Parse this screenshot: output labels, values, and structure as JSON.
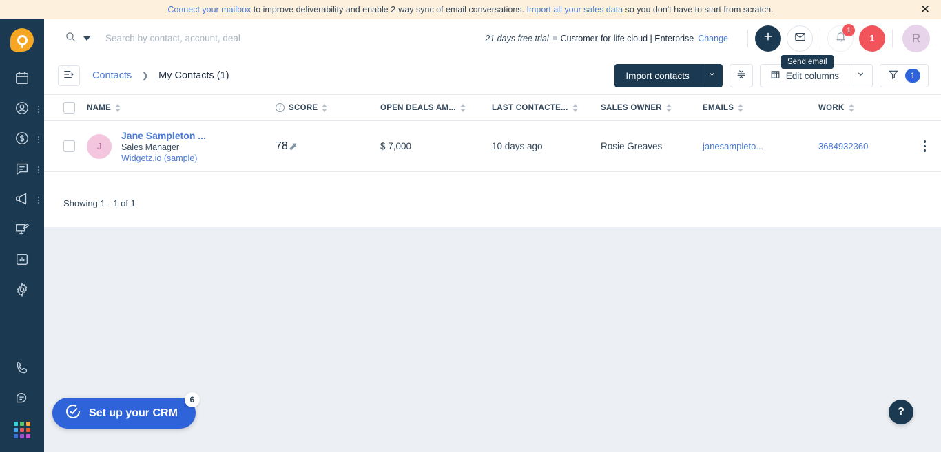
{
  "banner": {
    "link1": "Connect your mailbox",
    "text1": " to improve deliverability and enable 2-way sync of email conversations. ",
    "link2": "Import all your sales data",
    "text2": " so you don't have to start from scratch.",
    "close_icon": "close-icon"
  },
  "sidebar": {
    "logo_name": "freshworks-logo",
    "items": [
      {
        "name": "calendar",
        "icon": "calendar-icon",
        "has_dots": false
      },
      {
        "name": "contacts",
        "icon": "person-circle-icon",
        "has_dots": true
      },
      {
        "name": "deals",
        "icon": "dollar-circle-icon",
        "has_dots": true
      },
      {
        "name": "conversations",
        "icon": "chat-icon",
        "has_dots": true
      },
      {
        "name": "marketing",
        "icon": "megaphone-icon",
        "has_dots": true
      },
      {
        "name": "web-forms",
        "icon": "monitor-edit-icon",
        "has_dots": false
      },
      {
        "name": "reports",
        "icon": "bar-chart-icon",
        "has_dots": false
      },
      {
        "name": "settings",
        "icon": "gear-icon",
        "has_dots": false
      }
    ],
    "bottom_items": [
      {
        "name": "phone",
        "icon": "phone-icon"
      },
      {
        "name": "chat-support",
        "icon": "speech-bubble-icon"
      },
      {
        "name": "app-switcher",
        "icon": "app-grid-icon"
      }
    ],
    "app_grid_colors": [
      "#3ed0d6",
      "#4aa6f0",
      "#5cc46a",
      "#f0a93c",
      "#4aa6f0",
      "#f2545b",
      "#e05c2e",
      "#3d6fd0",
      "#a14fd0",
      "#c94fd0"
    ]
  },
  "topbar": {
    "search_icon": "search-icon",
    "search_dropdown_icon": "caret-down-icon",
    "search_placeholder": "Search by contact, account, deal",
    "search_value": "",
    "trial_days": "21 days free trial",
    "plan": "Customer-for-life cloud | Enterprise",
    "change_label": "Change",
    "add_icon": "plus-icon",
    "mail_icon": "envelope-icon",
    "mail_tooltip": "Send email",
    "bell_icon": "bell-icon",
    "bell_badge": "1",
    "count_badge": "1",
    "avatar_initial": "R"
  },
  "pagebar": {
    "panel_toggle_icon": "panel-toggle-icon",
    "breadcrumb_root": "Contacts",
    "breadcrumb_sep_icon": "chevron-right-icon",
    "breadcrumb_current": "My Contacts (1)",
    "import_label": "Import contacts",
    "import_arrow_icon": "chevron-down-icon",
    "collapse_icon": "collapse-rows-icon",
    "edit_columns_label": "Edit columns",
    "edit_columns_icon": "columns-icon",
    "edit_columns_arrow_icon": "chevron-down-icon",
    "filter_icon": "funnel-icon",
    "filter_count": "1"
  },
  "table": {
    "select_all_name": "select-all-checkbox",
    "columns": [
      {
        "label": "NAME",
        "info": false
      },
      {
        "label": "SCORE",
        "info": true
      },
      {
        "label": "OPEN DEALS AM...",
        "info": false
      },
      {
        "label": "LAST CONTACTE...",
        "info": false
      },
      {
        "label": "SALES OWNER",
        "info": false
      },
      {
        "label": "EMAILS",
        "info": false
      },
      {
        "label": "WORK",
        "info": false
      }
    ],
    "rows": [
      {
        "avatar_initial": "J",
        "name": "Jane Sampleton ...",
        "title": "Sales Manager",
        "company": "Widgetz.io (sample)",
        "score": "78",
        "score_trend_icon": "arrow-up-icon",
        "open_deals": "$ 7,000",
        "last_contacted": "10 days ago",
        "sales_owner": "Rosie Greaves",
        "email": "janesampleto...",
        "work": "3684932360",
        "menu_icon": "kebab-menu-icon"
      }
    ],
    "showing": "Showing 1 - 1 of 1"
  },
  "floating": {
    "crm_icon": "check-circle-icon",
    "crm_label": "Set up your CRM",
    "crm_badge": "6",
    "help_label": "?"
  },
  "colors": {
    "navy": "#1b3a52",
    "brand_orange": "#f7a623",
    "link_blue": "#4b7bd6",
    "accent_blue": "#2f63d9",
    "alert_red": "#f2545b",
    "banner_bg": "#fdf0dd"
  }
}
